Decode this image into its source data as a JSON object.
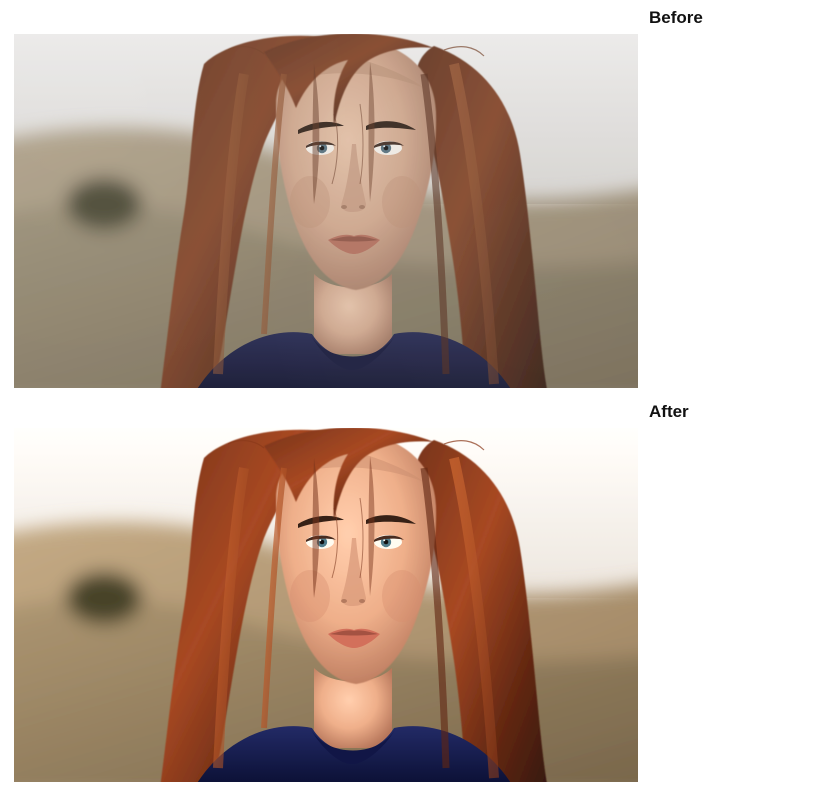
{
  "comparison": {
    "before": {
      "label": "Before"
    },
    "after": {
      "label": "After"
    }
  }
}
